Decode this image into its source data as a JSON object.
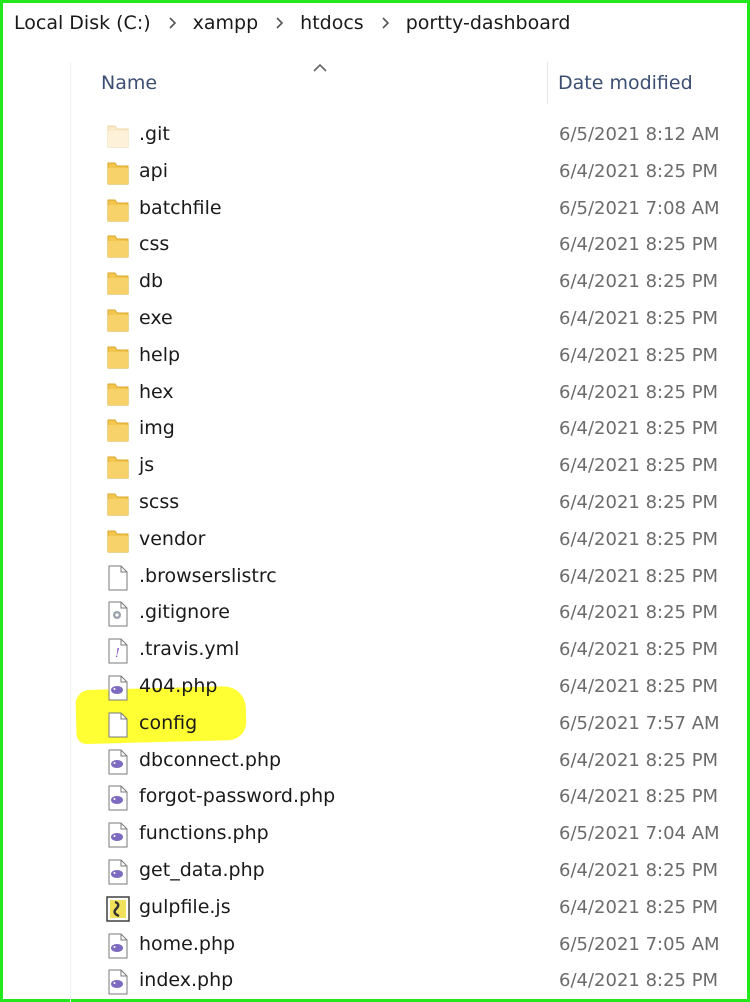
{
  "breadcrumb": {
    "items": [
      "Local Disk (C:)",
      "xampp",
      "htdocs",
      "portty-dashboard"
    ]
  },
  "columns": {
    "name": "Name",
    "date_modified": "Date modified"
  },
  "files": [
    {
      "name": ".git",
      "date": "6/5/2021 8:12 AM",
      "icon": "folder-faded-icon"
    },
    {
      "name": "api",
      "date": "6/4/2021 8:25 PM",
      "icon": "folder-icon"
    },
    {
      "name": "batchfile",
      "date": "6/5/2021 7:08 AM",
      "icon": "folder-icon"
    },
    {
      "name": "css",
      "date": "6/4/2021 8:25 PM",
      "icon": "folder-icon"
    },
    {
      "name": "db",
      "date": "6/4/2021 8:25 PM",
      "icon": "folder-icon"
    },
    {
      "name": "exe",
      "date": "6/4/2021 8:25 PM",
      "icon": "folder-icon"
    },
    {
      "name": "help",
      "date": "6/4/2021 8:25 PM",
      "icon": "folder-icon"
    },
    {
      "name": "hex",
      "date": "6/4/2021 8:25 PM",
      "icon": "folder-icon"
    },
    {
      "name": "img",
      "date": "6/4/2021 8:25 PM",
      "icon": "folder-icon"
    },
    {
      "name": "js",
      "date": "6/4/2021 8:25 PM",
      "icon": "folder-icon"
    },
    {
      "name": "scss",
      "date": "6/4/2021 8:25 PM",
      "icon": "folder-icon"
    },
    {
      "name": "vendor",
      "date": "6/4/2021 8:25 PM",
      "icon": "folder-icon"
    },
    {
      "name": ".browserslistrc",
      "date": "6/4/2021 8:25 PM",
      "icon": "blank-file-icon"
    },
    {
      "name": ".gitignore",
      "date": "6/4/2021 8:25 PM",
      "icon": "settings-file-icon"
    },
    {
      "name": ".travis.yml",
      "date": "6/4/2021 8:25 PM",
      "icon": "yml-file-icon"
    },
    {
      "name": "404.php",
      "date": "6/4/2021 8:25 PM",
      "icon": "php-file-icon"
    },
    {
      "name": "config",
      "date": "6/5/2021 7:57 AM",
      "icon": "blank-file-icon",
      "highlighted": true
    },
    {
      "name": "dbconnect.php",
      "date": "6/4/2021 8:25 PM",
      "icon": "php-file-icon"
    },
    {
      "name": "forgot-password.php",
      "date": "6/4/2021 8:25 PM",
      "icon": "php-file-icon"
    },
    {
      "name": "functions.php",
      "date": "6/5/2021 7:04 AM",
      "icon": "php-file-icon"
    },
    {
      "name": "get_data.php",
      "date": "6/4/2021 8:25 PM",
      "icon": "php-file-icon"
    },
    {
      "name": "gulpfile.js",
      "date": "6/4/2021 8:25 PM",
      "icon": "js-file-icon"
    },
    {
      "name": "home.php",
      "date": "6/5/2021 7:05 AM",
      "icon": "php-file-icon"
    },
    {
      "name": "index.php",
      "date": "6/4/2021 8:25 PM",
      "icon": "php-file-icon"
    }
  ],
  "colors": {
    "frame_border": "#22e81b",
    "highlight": "#ffff33",
    "header_text": "#3c4f73",
    "folder": "#f3c64f"
  }
}
